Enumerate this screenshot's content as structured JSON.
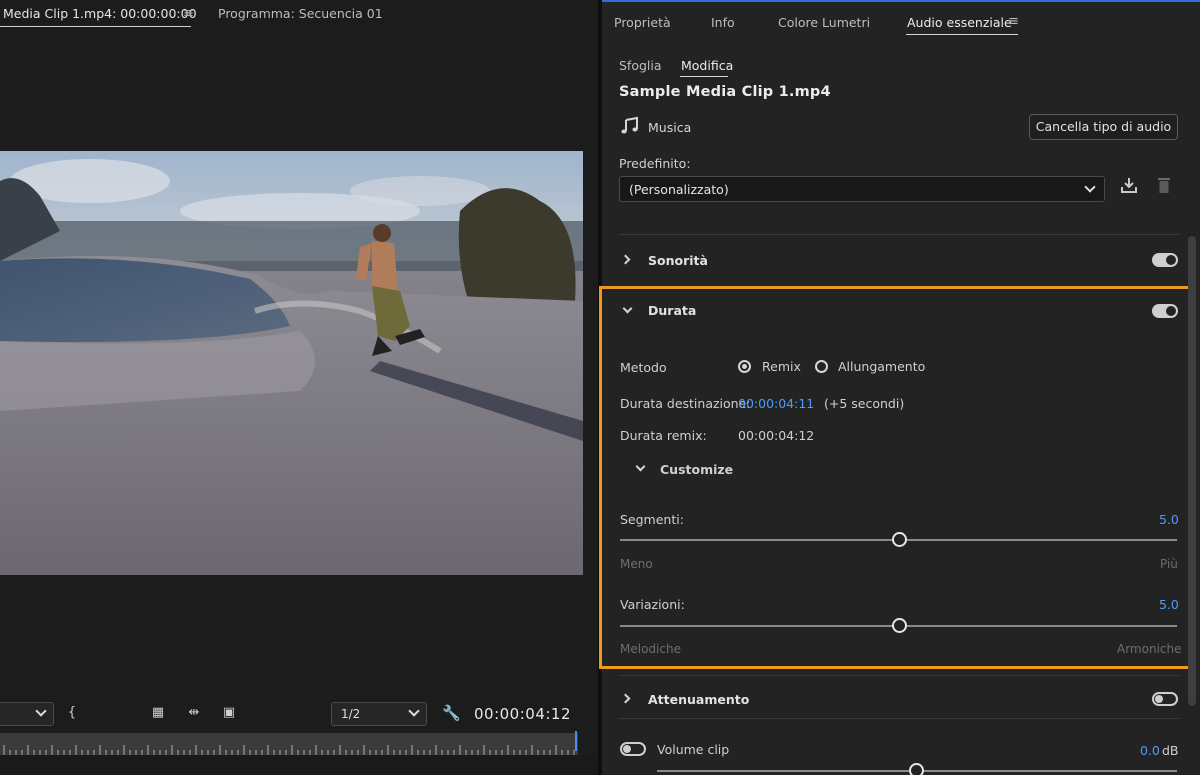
{
  "source_monitor": {
    "tab_label": "Media Clip 1.mp4: 00:00:00:00",
    "menu_glyph": "≡",
    "program_tab": "Programma: Secuencia 01",
    "resolution": "1/2",
    "timecode": "00:00:04:12"
  },
  "panel": {
    "tabs": [
      "Proprietà",
      "Info",
      "Colore Lumetri",
      "Audio essenziale"
    ],
    "active_tab_index": 3,
    "menu_glyph": "≡",
    "subtabs": [
      "Sfoglia",
      "Modifica"
    ],
    "active_subtab_index": 1,
    "clip_name": "Sample Media Clip 1.mp4",
    "audio_type": "Musica",
    "clear_button": "Cancella tipo di audio",
    "preset_label": "Predefinito:",
    "preset_value": "(Personalizzato)",
    "sections": {
      "loudness": {
        "title": "Sonorità",
        "enabled": true
      },
      "duration": {
        "title": "Durata",
        "enabled": true,
        "method_label": "Metodo",
        "method_options": [
          "Remix",
          "Allungamento"
        ],
        "method_selected": "Remix",
        "target_label": "Durata destinazione:",
        "target_value": "00:00:04:11",
        "target_delta": "(+5 secondi)",
        "remix_label": "Durata remix:",
        "remix_value": "00:00:04:12",
        "customize_label": "Customize",
        "segments": {
          "label": "Segmenti:",
          "value": "5.0",
          "min_label": "Meno",
          "max_label": "Più",
          "level": 0.5
        },
        "variations": {
          "label": "Variazioni:",
          "value": "5.0",
          "min_label": "Melodiche",
          "max_label": "Armoniche",
          "level": 0.5
        }
      },
      "ducking": {
        "title": "Attenuamento",
        "enabled": false
      },
      "clip_volume": {
        "title": "Volume clip",
        "enabled": false,
        "value": "0.0",
        "unit": "dB"
      }
    }
  },
  "colors": {
    "accent_blue": "#4d9df8",
    "highlight_orange": "#f09a1a"
  }
}
